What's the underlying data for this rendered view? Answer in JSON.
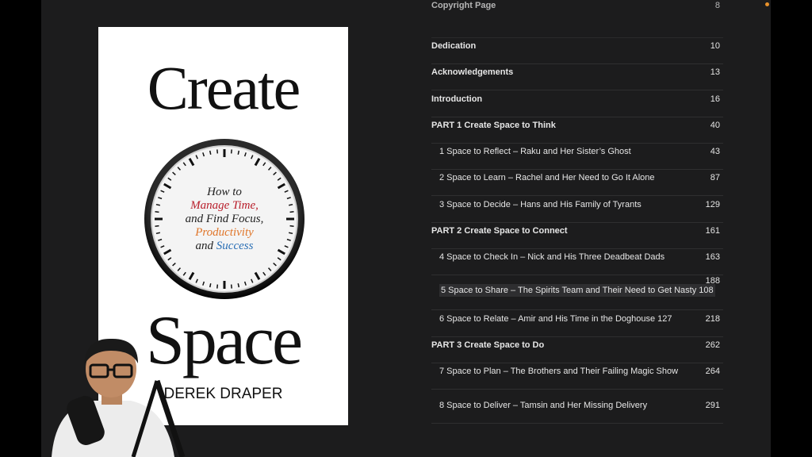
{
  "book": {
    "title_top": "Create",
    "title_bottom": "Space",
    "subtitle_lines": [
      "How to",
      "Manage Time,",
      "and Find Focus,",
      "Productivity",
      "and Success"
    ],
    "subtitle_last_prefix": "and ",
    "subtitle_last_word": "Success",
    "author": "DEREK DRAPER"
  },
  "toc": {
    "rows": [
      {
        "label": "Copyright Page",
        "page": "8",
        "type": "part"
      },
      {
        "label": "Dedication",
        "page": "10",
        "type": "part"
      },
      {
        "label": "Acknowledgements",
        "page": "13",
        "type": "part"
      },
      {
        "label": "Introduction",
        "page": "16",
        "type": "part"
      },
      {
        "label": "PART 1 Create Space to Think",
        "page": "40",
        "type": "part"
      },
      {
        "label": "1 Space to Reflect – Raku and Her Sister’s Ghost",
        "page": "43",
        "type": "sub"
      },
      {
        "label": "2 Space to Learn – Rachel and Her Need to Go It Alone",
        "page": "87",
        "type": "sub"
      },
      {
        "label": "3 Space to Decide – Hans and His Family of Tyrants",
        "page": "129",
        "type": "sub"
      },
      {
        "label": "PART 2 Create Space to Connect",
        "page": "161",
        "type": "part"
      },
      {
        "label": "4 Space to Check In – Nick and His Three Deadbeat Dads",
        "page": "163",
        "type": "sub"
      },
      {
        "label": "5 Space to Share – The Spirits Team and Their Need to Get Nasty 108",
        "page": "188",
        "type": "sub"
      },
      {
        "label": "6 Space to Relate – Amir and His Time in the Doghouse 127",
        "page": "218",
        "type": "sub"
      },
      {
        "label": "PART 3 Create Space to Do",
        "page": "262",
        "type": "part"
      },
      {
        "label": "7 Space to Plan – The Brothers and Their Failing Magic Show",
        "page": "264",
        "type": "sub"
      },
      {
        "label": "8 Space to Deliver – Tamsin and Her Missing Delivery",
        "page": "291",
        "type": "sub"
      }
    ]
  }
}
